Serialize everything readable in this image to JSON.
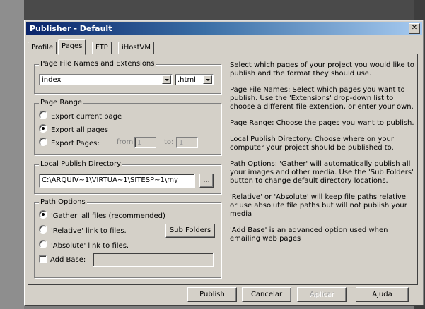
{
  "window": {
    "title": "Publisher - Default",
    "close_glyph": "✕"
  },
  "tabs": [
    {
      "label": "Profile",
      "active": false
    },
    {
      "label": "Pages",
      "active": true
    },
    {
      "label": "FTP",
      "active": false
    },
    {
      "label": "iHostVM",
      "active": false
    }
  ],
  "page_names": {
    "legend": "Page File Names and Extensions",
    "name_value": "index",
    "ext_value": ".html"
  },
  "page_range": {
    "legend": "Page Range",
    "options": [
      "Export current page",
      "Export all pages",
      "Export Pages:"
    ],
    "selected_index": 1,
    "from_label": "from:",
    "from_value": "1",
    "to_label": "to:",
    "to_value": "1"
  },
  "local_dir": {
    "legend": "Local Publish Directory",
    "path_value": "C:\\ARQUIV~1\\VIRTUA~1\\SITESP~1\\my",
    "browse_label": "..."
  },
  "path_options": {
    "legend": "Path Options",
    "options": [
      "'Gather' all files (recommended)",
      "'Relative' link to files.",
      "'Absolute' link to files."
    ],
    "selected_index": 0,
    "sub_folders_label": "Sub Folders",
    "add_base_label": "Add Base:",
    "add_base_checked": false,
    "add_base_value": ""
  },
  "help_text": [
    "Select which pages of your project you would like to publish and the format they should use.",
    "Page File Names: Select which pages you want to publish. Use the 'Extensions' drop-down list to choose a different file extension, or enter your own.",
    "Page Range: Choose the pages you want to publish.",
    "Local Publish Directory: Choose where on your computer your project should be published to.",
    "Path Options: 'Gather' will automatically publish all your images and other media. Use the 'Sub Folders' button to change default directory locations.",
    "'Relative' or 'Absolute' will keep file paths relative or use absolute file paths but will not publish your media",
    "'Add Base' is an advanced option used when emailing web pages"
  ],
  "buttons": {
    "publish": "Publish",
    "cancel": "Cancelar",
    "apply": "Aplicar",
    "help": "Ajuda"
  },
  "colors": {
    "title_start": "#0a246a",
    "title_end": "#a6caf0",
    "face": "#d4d0c8"
  }
}
